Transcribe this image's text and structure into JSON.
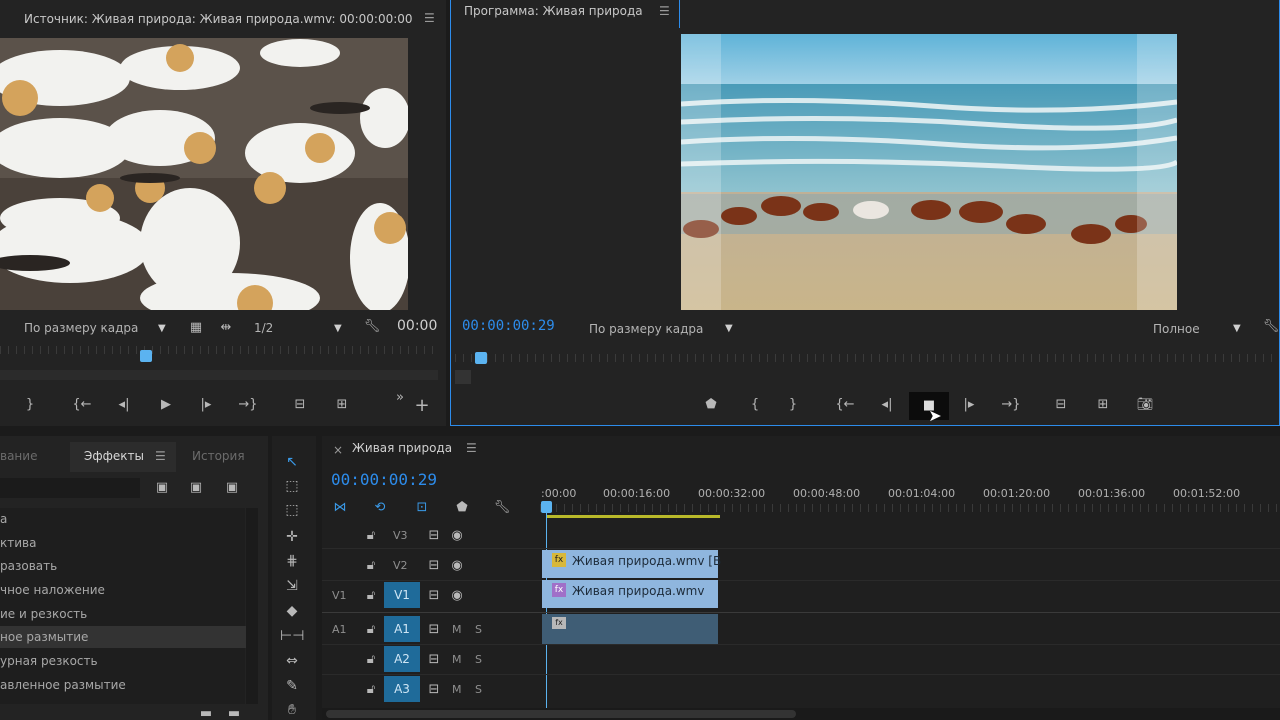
{
  "source": {
    "title": "Источник: Живая природа: Живая природа.wmv: 00:00:00:00",
    "fit": "По размеру кадра",
    "res": "1/2",
    "tc": "00:00"
  },
  "program": {
    "title": "Программа: Живая природа",
    "tc": "00:00:00:29",
    "fit": "По размеру кадра",
    "quality": "Полное"
  },
  "effects": {
    "tabs": [
      "ваниe",
      "Эффекты",
      "История"
    ],
    "items": [
      "а",
      "ктива",
      "разовать",
      "чное наложение",
      "ие и резкость",
      "ное размытие",
      "урная резкость",
      "авленное размытие"
    ],
    "selected_index": 5
  },
  "timeline": {
    "tab": "Живая природа",
    "tc": "00:00:00:29",
    "marks": [
      ":00:00",
      "00:00:16:00",
      "00:00:32:00",
      "00:00:48:00",
      "00:01:04:00",
      "00:01:20:00",
      "00:01:36:00",
      "00:01:52:00"
    ],
    "tracks": {
      "v3": "V3",
      "v2": "V2",
      "v1": "V1",
      "v1src": "V1",
      "a1": "A1",
      "a1src": "A1",
      "a2": "A2",
      "a3": "A3",
      "m": "M",
      "s": "S"
    },
    "clips": {
      "v2": "Живая природа.wmv [В",
      "v1": "Живая природа.wmv"
    }
  },
  "colors": {
    "accent": "#2d8ceb",
    "track_active": "#1f6b9a",
    "clip_video": "#8fb6de",
    "clip_audio": "#3f5d75"
  }
}
